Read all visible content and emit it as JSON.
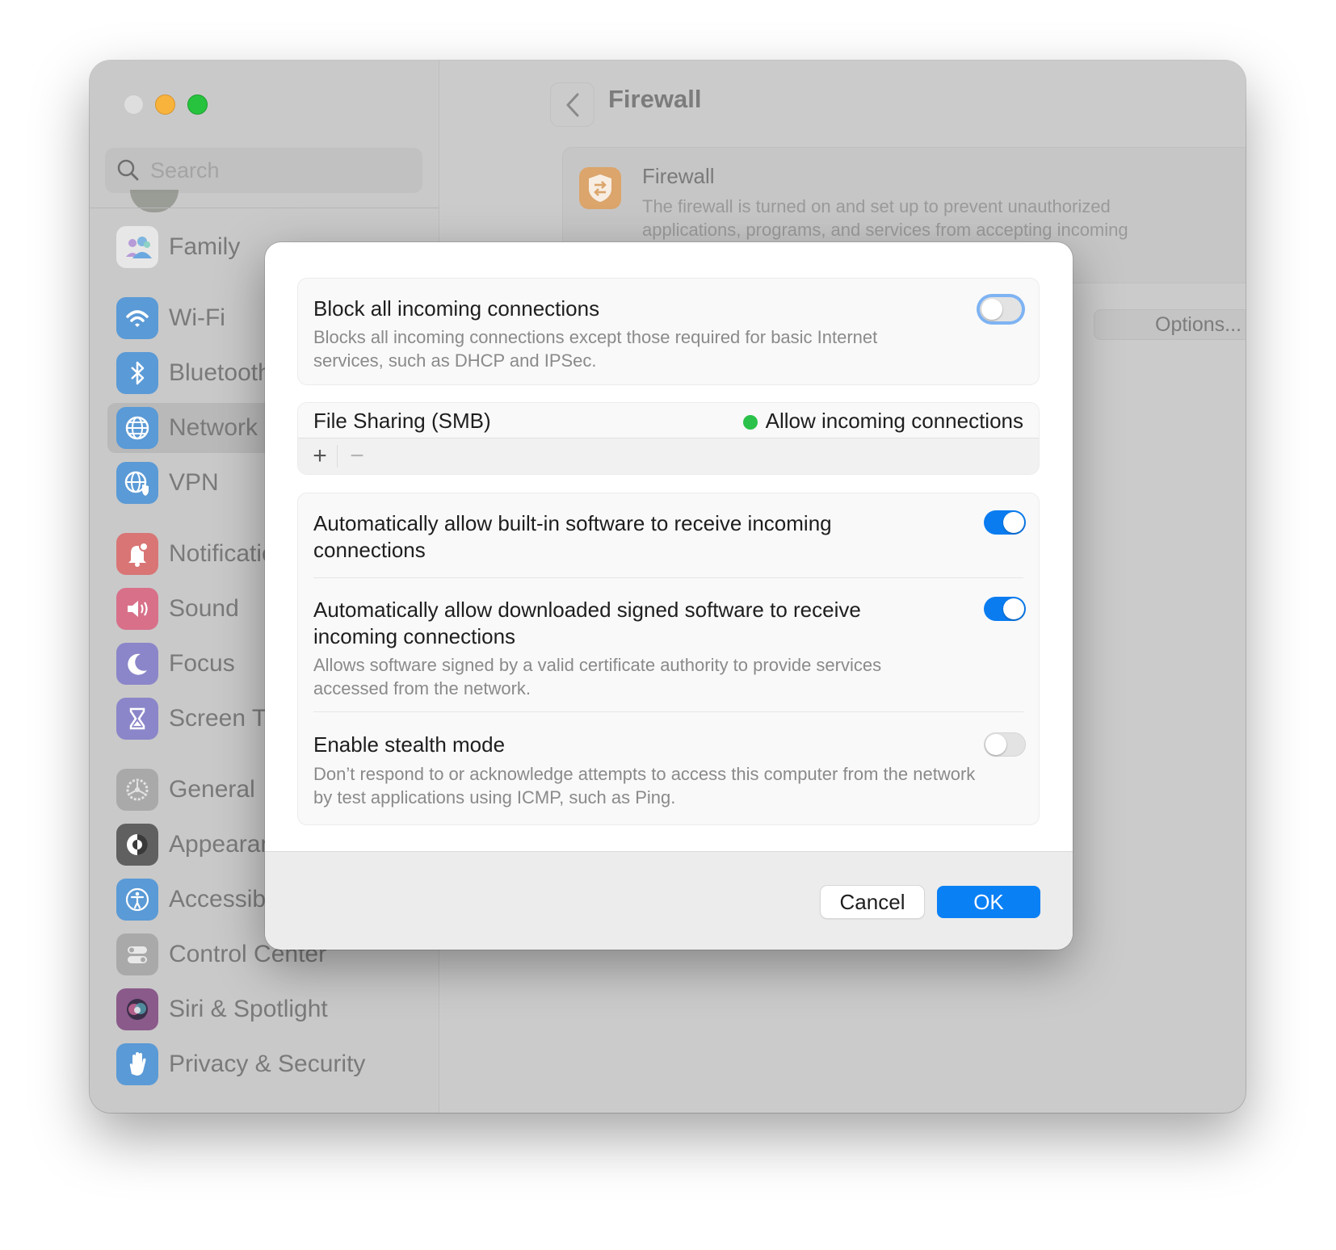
{
  "window": {
    "traffic_lights": [
      "close",
      "minimize",
      "maximize"
    ]
  },
  "sidebar": {
    "search_placeholder": "Search",
    "items": [
      {
        "label": "Family",
        "icon": "family-icon",
        "color": "#e7e7e7"
      },
      {
        "label": "Wi-Fi",
        "icon": "wifi-icon",
        "color": "#5a9ad6"
      },
      {
        "label": "Bluetooth",
        "icon": "bluetooth-icon",
        "color": "#5a9ad6"
      },
      {
        "label": "Network",
        "icon": "globe-icon",
        "color": "#5a9ad6",
        "active": true
      },
      {
        "label": "VPN",
        "icon": "vpn-icon",
        "color": "#5a9ad6"
      },
      {
        "label": "Notifications",
        "icon": "bell-icon",
        "color": "#d97575"
      },
      {
        "label": "Sound",
        "icon": "speaker-icon",
        "color": "#d8708a"
      },
      {
        "label": "Focus",
        "icon": "moon-icon",
        "color": "#8b86c9"
      },
      {
        "label": "Screen Time",
        "icon": "hourglass-icon",
        "color": "#8b86c9"
      },
      {
        "label": "General",
        "icon": "gear-icon",
        "color": "#a9a9a9"
      },
      {
        "label": "Appearance",
        "icon": "appearance-icon",
        "color": "#606060"
      },
      {
        "label": "Accessibility",
        "icon": "accessibility-icon",
        "color": "#5a9ad6"
      },
      {
        "label": "Control Center",
        "icon": "control-center-icon",
        "color": "#a9a9a9"
      },
      {
        "label": "Siri & Spotlight",
        "icon": "siri-icon",
        "color": "#8a5a8a"
      },
      {
        "label": "Privacy & Security",
        "icon": "hand-icon",
        "color": "#5a9ad6"
      }
    ]
  },
  "main": {
    "title": "Firewall",
    "card": {
      "title": "Firewall",
      "description": "The firewall is turned on and set up to prevent unauthorized applications, programs, and services from accepting incoming connections.",
      "enabled": true
    },
    "options_label": "Options...",
    "help_label": "?"
  },
  "dialog": {
    "block_all": {
      "title": "Block all incoming connections",
      "description": "Blocks all incoming connections except those required for basic Internet services, such as DHCP and IPSec.",
      "enabled": false
    },
    "apps": [
      {
        "name": "File Sharing (SMB)",
        "status": "Allow incoming connections",
        "status_color": "#2ac24a"
      }
    ],
    "add_label": "+",
    "remove_label": "−",
    "builtin": {
      "title": "Automatically allow built-in software to receive incoming connections",
      "enabled": true
    },
    "signed": {
      "title": "Automatically allow downloaded signed software to receive incoming connections",
      "description": "Allows software signed by a valid certificate authority to provide services accessed from the network.",
      "enabled": true
    },
    "stealth": {
      "title": "Enable stealth mode",
      "description": "Don’t respond to or acknowledge attempts to access this computer from the network by test applications using ICMP, such as Ping.",
      "enabled": false
    },
    "cancel_label": "Cancel",
    "ok_label": "OK",
    "accent_color": "#0a80f5"
  }
}
